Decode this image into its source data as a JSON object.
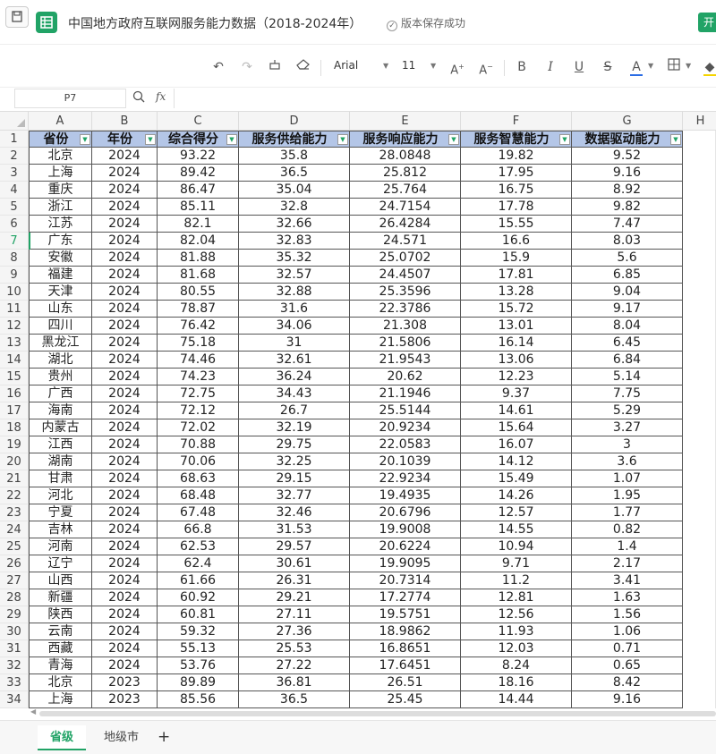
{
  "titlebar": {
    "doc_title": "中国地方政府互联网服务能力数据（2018-2024年）",
    "save_status": "版本保存成功",
    "open_label": "开"
  },
  "toolbar": {
    "font": "Arial",
    "size": "11",
    "icons": [
      "undo-icon",
      "redo-icon",
      "format-painter-icon",
      "clear-format-icon",
      "increase-font-icon",
      "decrease-font-icon",
      "bold-icon",
      "italic-icon",
      "underline-icon",
      "strikethrough-icon",
      "font-color-icon",
      "border-icon",
      "fill-color-icon"
    ]
  },
  "formula": {
    "cell_ref": "P7",
    "fx": "fx",
    "value": ""
  },
  "columns": [
    "A",
    "B",
    "C",
    "D",
    "E",
    "F",
    "G",
    "H"
  ],
  "headers": [
    "省份",
    "年份",
    "综合得分",
    "服务供给能力",
    "服务响应能力",
    "服务智慧能力",
    "数据驱动能力"
  ],
  "rows": [
    [
      "北京",
      "2024",
      "93.22",
      "35.8",
      "28.0848",
      "19.82",
      "9.52"
    ],
    [
      "上海",
      "2024",
      "89.42",
      "36.5",
      "25.812",
      "17.95",
      "9.16"
    ],
    [
      "重庆",
      "2024",
      "86.47",
      "35.04",
      "25.764",
      "16.75",
      "8.92"
    ],
    [
      "浙江",
      "2024",
      "85.11",
      "32.8",
      "24.7154",
      "17.78",
      "9.82"
    ],
    [
      "江苏",
      "2024",
      "82.1",
      "32.66",
      "26.4284",
      "15.55",
      "7.47"
    ],
    [
      "广东",
      "2024",
      "82.04",
      "32.83",
      "24.571",
      "16.6",
      "8.03"
    ],
    [
      "安徽",
      "2024",
      "81.88",
      "35.32",
      "25.0702",
      "15.9",
      "5.6"
    ],
    [
      "福建",
      "2024",
      "81.68",
      "32.57",
      "24.4507",
      "17.81",
      "6.85"
    ],
    [
      "天津",
      "2024",
      "80.55",
      "32.88",
      "25.3596",
      "13.28",
      "9.04"
    ],
    [
      "山东",
      "2024",
      "78.87",
      "31.6",
      "22.3786",
      "15.72",
      "9.17"
    ],
    [
      "四川",
      "2024",
      "76.42",
      "34.06",
      "21.308",
      "13.01",
      "8.04"
    ],
    [
      "黑龙江",
      "2024",
      "75.18",
      "31",
      "21.5806",
      "16.14",
      "6.45"
    ],
    [
      "湖北",
      "2024",
      "74.46",
      "32.61",
      "21.9543",
      "13.06",
      "6.84"
    ],
    [
      "贵州",
      "2024",
      "74.23",
      "36.24",
      "20.62",
      "12.23",
      "5.14"
    ],
    [
      "广西",
      "2024",
      "72.75",
      "34.43",
      "21.1946",
      "9.37",
      "7.75"
    ],
    [
      "海南",
      "2024",
      "72.12",
      "26.7",
      "25.5144",
      "14.61",
      "5.29"
    ],
    [
      "内蒙古",
      "2024",
      "72.02",
      "32.19",
      "20.9234",
      "15.64",
      "3.27"
    ],
    [
      "江西",
      "2024",
      "70.88",
      "29.75",
      "22.0583",
      "16.07",
      "3"
    ],
    [
      "湖南",
      "2024",
      "70.06",
      "32.25",
      "20.1039",
      "14.12",
      "3.6"
    ],
    [
      "甘肃",
      "2024",
      "68.63",
      "29.15",
      "22.9234",
      "15.49",
      "1.07"
    ],
    [
      "河北",
      "2024",
      "68.48",
      "32.77",
      "19.4935",
      "14.26",
      "1.95"
    ],
    [
      "宁夏",
      "2024",
      "67.48",
      "32.46",
      "20.6796",
      "12.57",
      "1.77"
    ],
    [
      "吉林",
      "2024",
      "66.8",
      "31.53",
      "19.9008",
      "14.55",
      "0.82"
    ],
    [
      "河南",
      "2024",
      "62.53",
      "29.57",
      "20.6224",
      "10.94",
      "1.4"
    ],
    [
      "辽宁",
      "2024",
      "62.4",
      "30.61",
      "19.9095",
      "9.71",
      "2.17"
    ],
    [
      "山西",
      "2024",
      "61.66",
      "26.31",
      "20.7314",
      "11.2",
      "3.41"
    ],
    [
      "新疆",
      "2024",
      "60.92",
      "29.21",
      "17.2774",
      "12.81",
      "1.63"
    ],
    [
      "陕西",
      "2024",
      "60.81",
      "27.11",
      "19.5751",
      "12.56",
      "1.56"
    ],
    [
      "云南",
      "2024",
      "59.32",
      "27.36",
      "18.9862",
      "11.93",
      "1.06"
    ],
    [
      "西藏",
      "2024",
      "55.13",
      "25.53",
      "16.8651",
      "12.03",
      "0.71"
    ],
    [
      "青海",
      "2024",
      "53.76",
      "27.22",
      "17.6451",
      "8.24",
      "0.65"
    ],
    [
      "北京",
      "2023",
      "89.89",
      "36.81",
      "26.51",
      "18.16",
      "8.42"
    ],
    [
      "上海",
      "2023",
      "85.56",
      "36.5",
      "25.45",
      "14.44",
      "9.16"
    ]
  ],
  "selected_row": 7,
  "tabs": [
    "省级",
    "地级市"
  ],
  "active_tab": 0
}
